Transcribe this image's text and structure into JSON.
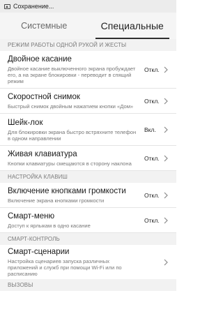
{
  "status_bar": {
    "text": "Сохранение..."
  },
  "tabs": [
    {
      "label": "Системные",
      "active": false
    },
    {
      "label": "Специальные",
      "active": true
    }
  ],
  "sections": {
    "one_hand": "РЕЖИМ РАБОТЫ ОДНОЙ РУКОЙ И ЖЕСТЫ",
    "keys": "НАСТРОЙКА КЛАВИШ",
    "smart": "СМАРТ-КОНТРОЛЬ",
    "calls": "ВЫЗОВЫ"
  },
  "items": [
    {
      "title": "Двойное касание",
      "description": "Двойное касание выключенного экрана пробуждает его, а на экране блокировки - переводит в спящий режим",
      "value": "Откл."
    },
    {
      "title": "Скоростной снимок",
      "description": "Быстрый снимок двойным нажатием кнопки «Дом»",
      "value": "Откл."
    },
    {
      "title": "Шейк-лок",
      "description": "Для блокировки экрана быстро встряхните телефон в одном направлении",
      "value": "Вкл."
    },
    {
      "title": "Живая клавиатура",
      "description": "Кнопки клавиатуры смещаются в сторону наклона",
      "value": "Откл."
    },
    {
      "title": "Включение кнопками громкости",
      "description": "Включение экрана кнопками громкости",
      "value": "Откл."
    },
    {
      "title": "Смарт-меню",
      "description": "Доступ к ярлыкам в одно касание",
      "value": "Откл."
    },
    {
      "title": "Смарт-сценарии",
      "description": "Настройка сценариев запуска различных приложений и служб при помощи Wi-Fi или по расписанию",
      "value": ""
    }
  ],
  "icons": {
    "chevron": "chevron-right-icon",
    "status": "image-icon"
  },
  "colors": {
    "divider": "#e4e4e4",
    "section_bg": "#f2f2f2",
    "tab_indicator": "#2f2f2f"
  }
}
